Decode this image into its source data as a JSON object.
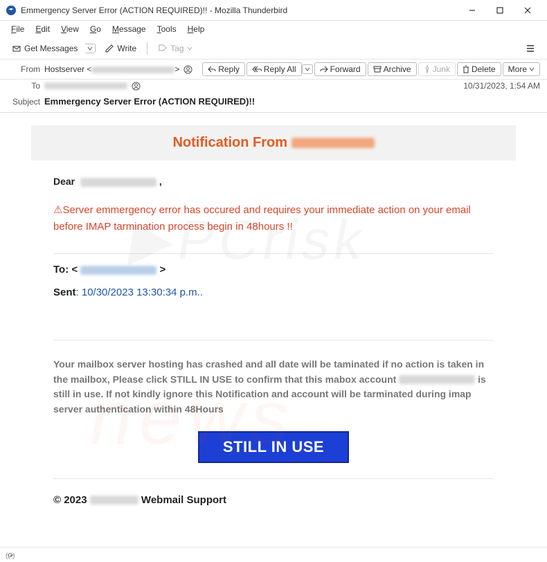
{
  "window": {
    "title": "Emmergency Server Error (ACTION REQUIRED)!! - Mozilla Thunderbird"
  },
  "menu": {
    "file": "File",
    "edit": "Edit",
    "view": "View",
    "go": "Go",
    "message": "Message",
    "tools": "Tools",
    "help": "Help"
  },
  "toolbar": {
    "get_messages": "Get Messages",
    "write": "Write",
    "tag": "Tag"
  },
  "headers": {
    "from_label": "From",
    "from_value": "Hostserver <",
    "from_close": ">",
    "to_label": "To",
    "subject_label": "Subject",
    "subject_value": "Emmergency Server Error (ACTION REQUIRED)!!",
    "date": "10/31/2023, 1:54 AM"
  },
  "actions": {
    "reply": "Reply",
    "reply_all": "Reply All",
    "forward": "Forward",
    "archive": "Archive",
    "junk": "Junk",
    "delete": "Delete",
    "more": "More"
  },
  "email": {
    "notif_prefix": "Notification From ",
    "dear": "Dear",
    "dear_comma": ",",
    "warn": "⚠Server emmergency error has occured and requires your immediate action on your email before IMAP tarmination process begin in 48hours !!",
    "to_label": "To:",
    "to_open": "<",
    "to_close": ">",
    "sent_label": "Sent",
    "sent_value": ": 10/30/2023 13:30:34 p.m..",
    "body1": "Your mailbox server hosting has crashed and all date will be taminated if no action is taken in the mailbox, Please click STILL IN USE to confirm that this mabox account",
    "body2": "is still in use. If not kindly ignore this Notification and account will be tarminated during imap server authentication within 48Hours",
    "button": "STILL IN USE",
    "footer_prefix": "©  2023 ",
    "footer_suffix": " Webmail Support"
  }
}
